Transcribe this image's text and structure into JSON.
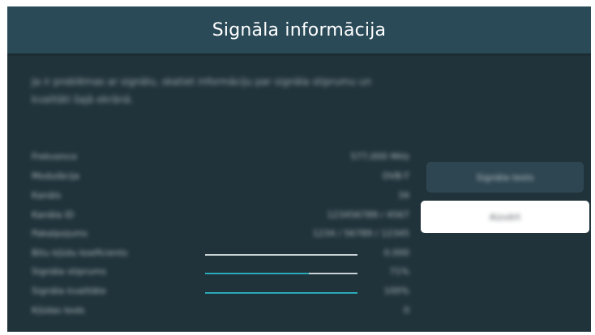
{
  "dialog": {
    "title": "Signāla informācija",
    "description": "Ja ir problēmas ar signālu, skatiet informāciju par signāla stiprumu un kvalitāti šajā ekrānā."
  },
  "info_rows": [
    {
      "label": "Frekvence",
      "value": "577,000 MHz"
    },
    {
      "label": "Modulācija",
      "value": "DVB-T"
    },
    {
      "label": "Kanāls",
      "value": "34"
    },
    {
      "label": "Kanāla ID",
      "value": "123456789 / 4567"
    },
    {
      "label": "Pakalpojums",
      "value": "1234 / 56789 / 12345"
    },
    {
      "label": "Bitu kļūdu koeficients",
      "value": "0.000",
      "bar": 0
    },
    {
      "label": "Signāla stiprums",
      "value": "71%",
      "bar": 0.68
    },
    {
      "label": "Signāla kvalitāte",
      "value": "100%",
      "bar": 1.0
    },
    {
      "label": "Kļūdas kods",
      "value": "0"
    }
  ],
  "buttons": {
    "signal_test": "Signāla tests",
    "close": "Aizvērt"
  },
  "colors": {
    "panel": "#20323a",
    "title_bar": "#2a4a58",
    "bar_fill": "#2aa9b8",
    "bar_track": "#c9d3d6",
    "selected_button": "#ffffff"
  }
}
